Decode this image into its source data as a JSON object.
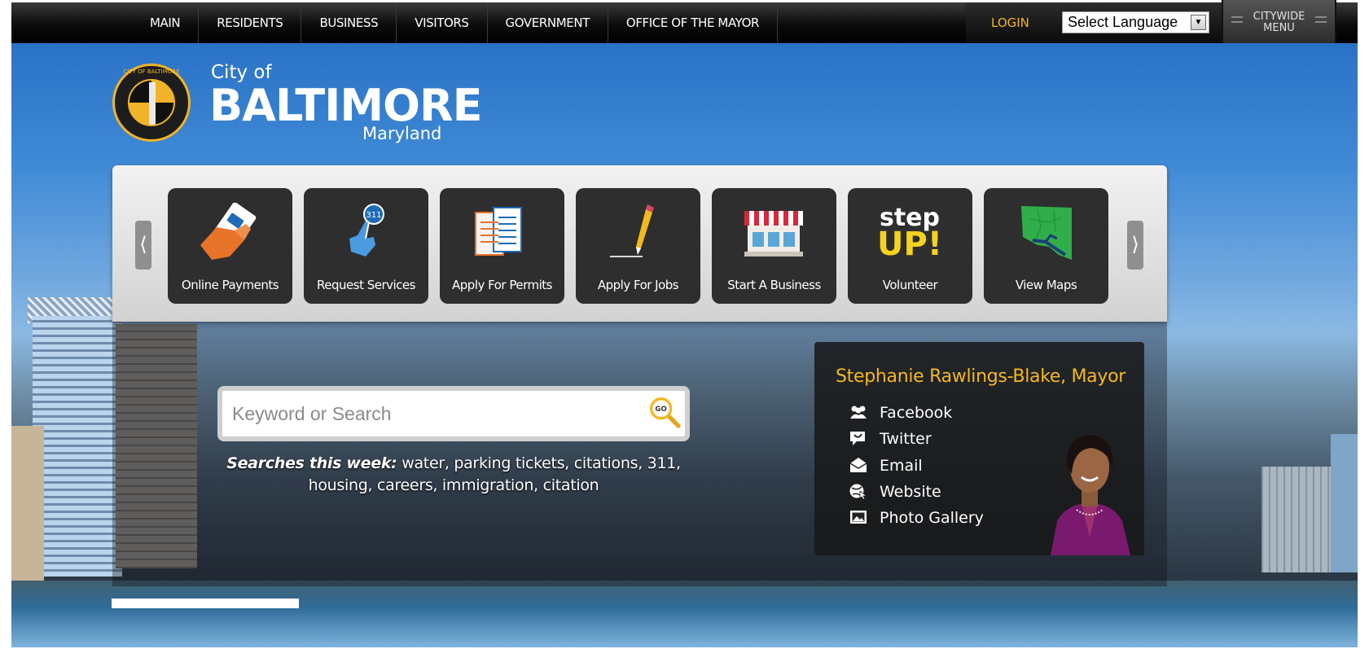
{
  "nav": {
    "items": [
      {
        "label": "MAIN"
      },
      {
        "label": "RESIDENTS"
      },
      {
        "label": "BUSINESS"
      },
      {
        "label": "VISITORS"
      },
      {
        "label": "GOVERNMENT"
      },
      {
        "label": "OFFICE OF THE MAYOR"
      }
    ],
    "login": "LOGIN",
    "language_select": "Select Language",
    "citywide_menu_line1": "CITYWIDE",
    "citywide_menu_line2": "MENU"
  },
  "logo": {
    "seal_text": "CITY OF BALTIMORE",
    "city_of": "City of",
    "city": "BALTIMORE",
    "state": "Maryland"
  },
  "quick_links": {
    "prev": "⟨",
    "next": "⟩",
    "tiles": [
      {
        "label": "Online Payments",
        "icon": "payment-hand-icon"
      },
      {
        "label": "Request Services",
        "icon": "311-pointer-icon"
      },
      {
        "label": "Apply For Permits",
        "icon": "documents-icon"
      },
      {
        "label": "Apply For Jobs",
        "icon": "pencil-sign-icon"
      },
      {
        "label": "Start A Business",
        "icon": "storefront-icon"
      },
      {
        "label": "Volunteer",
        "icon": "step-up-icon",
        "icon_text_top": "step",
        "icon_text_bottom": "UP!"
      },
      {
        "label": "View Maps",
        "icon": "baltimore-map-icon"
      }
    ]
  },
  "search": {
    "placeholder": "Keyword or Search",
    "go_label": "GO",
    "this_week_label": "Searches this week:",
    "this_week_terms": "water, parking tickets, citations, 311, housing, careers, immigration, citation"
  },
  "mayor": {
    "name": "Stephanie Rawlings-Blake, Mayor",
    "links": [
      {
        "label": "Facebook",
        "icon": "people-icon"
      },
      {
        "label": "Twitter",
        "icon": "twitter-bubble-icon"
      },
      {
        "label": "Email",
        "icon": "envelope-icon"
      },
      {
        "label": "Website",
        "icon": "globe-cursor-icon"
      },
      {
        "label": "Photo Gallery",
        "icon": "photo-icon"
      }
    ]
  },
  "colors": {
    "accent": "#f4b81f",
    "nav_bg": "#0c0c0c",
    "tile_bg": "#2e2e2e"
  }
}
